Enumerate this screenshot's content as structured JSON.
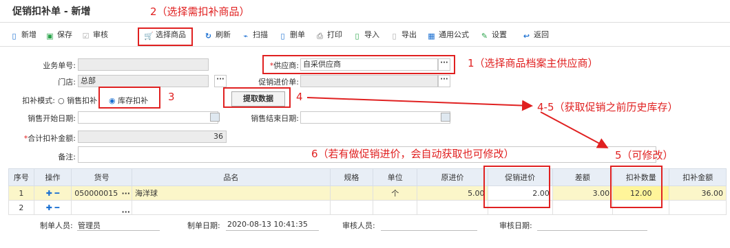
{
  "header": {
    "title": "促销扣补单 - 新增"
  },
  "toolbar": {
    "new": "新增",
    "save": "保存",
    "audit": "审核",
    "select_goods": "选择商品",
    "refresh": "刷新",
    "scan": "扫描",
    "delete_row": "删单",
    "print": "打印",
    "import": "导入",
    "export": "导出",
    "formula": "通用公式",
    "settings": "设置",
    "back": "返回"
  },
  "form": {
    "order_no_label": "业务单号:",
    "supplier_label": "供应商:",
    "supplier_value": "自采供应商",
    "store_label": "门店:",
    "store_value": "总部",
    "promo_price_doc_label": "促销进价单:",
    "mode_label": "扣补模式:",
    "mode_sales": "销售扣补",
    "mode_stock": "库存扣补",
    "fetch_button": "提取数据",
    "sales_start_label": "销售开始日期:",
    "sales_end_label": "销售结束日期:",
    "total_label": "合计扣补金额:",
    "total_value": "36",
    "remark_label": "备注:"
  },
  "annotations": {
    "a1": "1（选择商品档案主供应商）",
    "a2": "2（选择需扣补商品）",
    "a3": "3",
    "a4": "4",
    "a45": "4-5（获取促销之前历史库存）",
    "a5": "5（可修改）",
    "a6": "6（若有做促销进价，会自动获取也可修改）"
  },
  "table": {
    "headers": [
      "序号",
      "操作",
      "货号",
      "品名",
      "规格",
      "单位",
      "原进价",
      "促销进价",
      "差额",
      "扣补数量",
      "扣补金额"
    ],
    "rows": [
      {
        "no": "1",
        "sku": "050000015",
        "name": "海洋球",
        "spec": "",
        "unit": "个",
        "orig": "5.00",
        "promo": "2.00",
        "diff": "3.00",
        "qty": "12.00",
        "amount": "36.00"
      },
      {
        "no": "2",
        "sku": "",
        "name": "",
        "spec": "",
        "unit": "",
        "orig": "",
        "promo": "",
        "diff": "",
        "qty": "",
        "amount": ""
      }
    ]
  },
  "footer": {
    "maker_label": "制单人员:",
    "maker_value": "管理员",
    "date_label": "制单日期:",
    "date_value": "2020-08-13 10:41:35",
    "auditor_label": "审核人员:",
    "audit_date_label": "审核日期:"
  }
}
